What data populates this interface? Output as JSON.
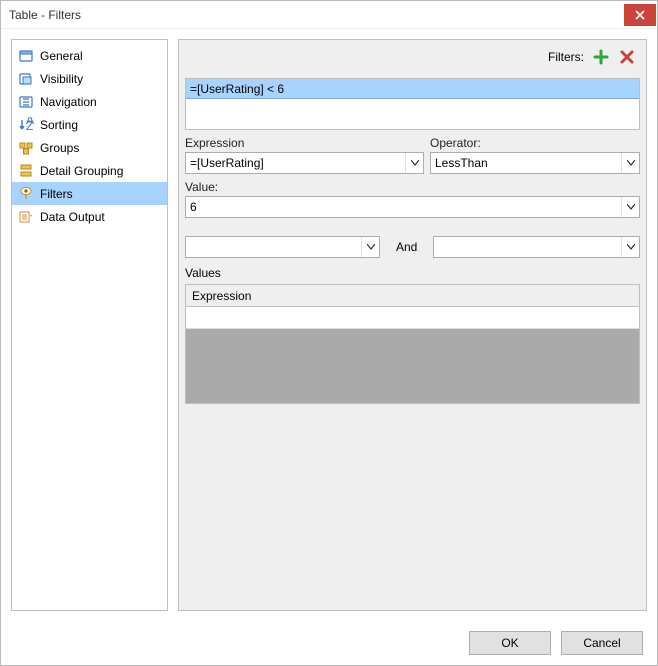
{
  "window": {
    "title": "Table - Filters"
  },
  "sidebar": {
    "items": [
      {
        "label": "General"
      },
      {
        "label": "Visibility"
      },
      {
        "label": "Navigation"
      },
      {
        "label": "Sorting"
      },
      {
        "label": "Groups"
      },
      {
        "label": "Detail Grouping"
      },
      {
        "label": "Filters"
      },
      {
        "label": "Data Output"
      }
    ],
    "selected_index": 6
  },
  "main": {
    "filters_header_label": "Filters:",
    "filter_items": [
      {
        "text": "=[UserRating] < 6"
      }
    ],
    "expression_label": "Expression",
    "expression_value": "=[UserRating]",
    "operator_label": "Operator:",
    "operator_value": "LessThan",
    "value_label": "Value:",
    "value_value": "6",
    "and_label": "And",
    "left_combo_value": "",
    "right_combo_value": "",
    "values_label": "Values",
    "values_grid_header": "Expression"
  },
  "footer": {
    "ok_label": "OK",
    "cancel_label": "Cancel"
  }
}
